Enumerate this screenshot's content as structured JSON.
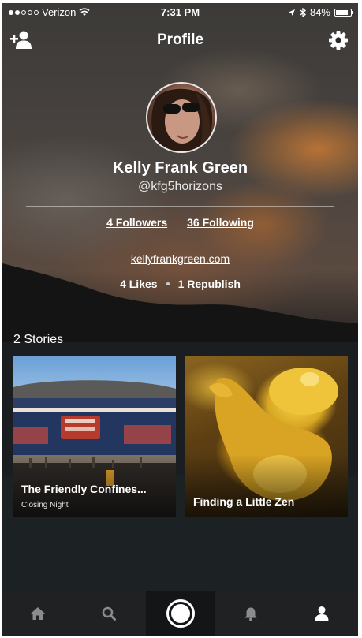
{
  "status_bar": {
    "carrier": "Verizon",
    "time": "7:31 PM",
    "battery": "84%",
    "battery_level": 0.84,
    "signal_bars_filled": 2,
    "signal_bars_total": 5
  },
  "nav": {
    "title": "Profile",
    "left_icon": "add-user-icon",
    "right_icon": "gear-icon"
  },
  "profile": {
    "name": "Kelly Frank Green",
    "handle": "@kfg5horizons",
    "followers": "4 Followers",
    "following": "36 Following",
    "website": "kellyfrankgreen.com",
    "likes": "4 Likes",
    "republish": "1 Republish"
  },
  "stories": {
    "count_label": "2 Stories",
    "items": [
      {
        "title": "The Friendly Confines...",
        "subtitle": "Closing Night"
      },
      {
        "title": "Finding a Little Zen",
        "subtitle": ""
      }
    ]
  },
  "tab_bar": {
    "items": [
      {
        "icon": "home-icon"
      },
      {
        "icon": "search-icon"
      },
      {
        "icon": "camera-icon"
      },
      {
        "icon": "bell-icon"
      },
      {
        "icon": "user-icon",
        "active": true
      }
    ]
  },
  "colors": {
    "tab_bar_bg": "#1f2123",
    "text": "#ffffff"
  }
}
